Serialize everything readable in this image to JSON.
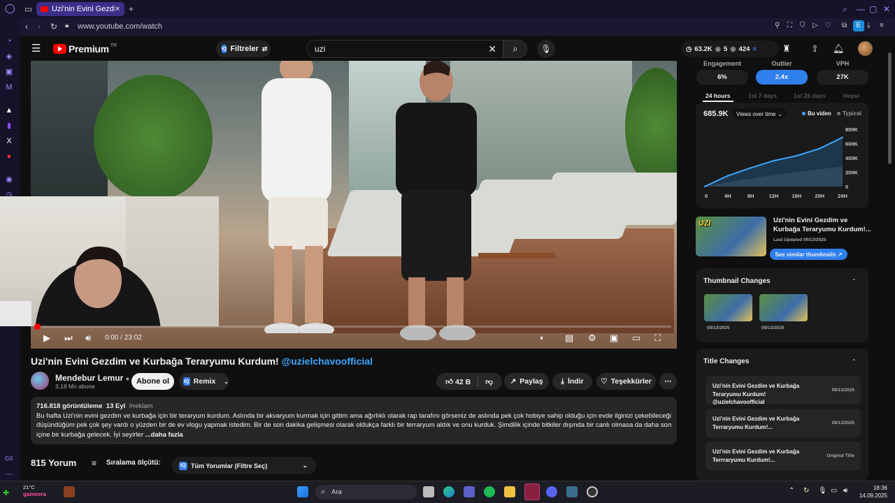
{
  "browser": {
    "tab_title": "Uzi'nin Evini Gezdim ve K",
    "url": "www.youtube.com/watch"
  },
  "header": {
    "logo": "Premium",
    "logo_region": "TR",
    "filter_label": "Filtreler",
    "search_value": "uzi",
    "stats": {
      "views": "63.2K",
      "count_a": "5",
      "count_b": "424"
    }
  },
  "video": {
    "time": "0:00 / 23:02",
    "title": "Uzi'nin Evini Gezdim ve Kurbağa Teraryumu Kurdum!",
    "title_tag": "@uzielchavoofficial",
    "progress": 0.002
  },
  "channel": {
    "name": "Mendebur Lemur",
    "subs": "3,18 Mn abone",
    "subscribe": "Abone ol",
    "remix": "Remix"
  },
  "actions": {
    "likes": "42 B",
    "share": "Paylaş",
    "download": "İndir",
    "thanks": "Teşekkürler"
  },
  "description": {
    "views": "716.818 görüntüleme",
    "date": "13 Eyl",
    "hashtag": "#reklam",
    "line1": "Bu hafta Uzi'nin evini gezdim ve kurbağa için bir teraryum kurdum.  Aslında bir akvaryum kurmak için gittim ama ağırlıklı olarak rap tarafını görseniz de aslında pek çok hobiye sahip olduğu için evde ilginizi çekebileceğini",
    "line2": "düşündüğüm pek çok şey vardı o yüzden bir de ev vlogu yapmak istedim. Bir de son dakika gelişmesi olarak oldukça farklı bir terraryum aldık ve onu kurduk. Şimdilik içinde bitkiler dışında bir canlı olmasa da daha sonra",
    "line3": "içine bir kurbağa gelecek. İyi seyirler",
    "more": "...daha fazla"
  },
  "comments": {
    "count": "815 Yorum",
    "sort_label": "Sıralama ölçütü:",
    "sort_value": "Tüm Yorumlar (Filtre Seç)"
  },
  "panel": {
    "metrics": [
      {
        "label": "Engagement",
        "value": "6%"
      },
      {
        "label": "Outlier",
        "value": "2.4x"
      },
      {
        "label": "VPH",
        "value": "27K"
      }
    ],
    "tabs": [
      "24 hours",
      "1st 7 days",
      "1st 28 days",
      "Hepsi"
    ],
    "views": "685.9K",
    "chart_mode": "Views over time",
    "legend_this": "Bu video",
    "legend_typical": "Typical",
    "thumb_title": "Uzi'nin Evini Gezdim ve Kurbağa Teraryumu Kurdum!...",
    "last_updated": "Last Updated 09/13/2025",
    "similar": "See similar thumbnails",
    "thumb_changes_title": "Thumbnail Changes",
    "thumb_dates": [
      "09/13/2025",
      "09/13/2025"
    ],
    "title_changes_title": "Title Changes",
    "title_changes": [
      {
        "text": "Uzi'nin Evini Gezdim ve Kurbağa Teraryumu Kurdum! @uzielchavoofficial",
        "date": "09/13/2025"
      },
      {
        "text": "Uzi'nin Evini Gezdim ve Kurbağa Terraryumu Kurdum!...",
        "date": "09/13/2025"
      },
      {
        "text": "Uzi'nin Evini Gezdim ve Kurbağa Terrraryumu Kurdum!...",
        "date": "Original Title"
      }
    ]
  },
  "chart_data": {
    "type": "area",
    "title": "",
    "x": [
      "0",
      "4H",
      "8H",
      "12H",
      "16H",
      "20H",
      "24H"
    ],
    "y_ticks": [
      "0",
      "200K",
      "400K",
      "600K",
      "800K"
    ],
    "ylim": [
      0,
      800000
    ],
    "series": [
      {
        "name": "Bu video",
        "values": [
          0,
          150000,
          260000,
          360000,
          430000,
          530000,
          686000
        ]
      },
      {
        "name": "Typical",
        "values": [
          0,
          60000,
          110000,
          160000,
          200000,
          240000,
          280000
        ]
      }
    ]
  },
  "taskbar": {
    "weather": "21°C",
    "search": "Ara",
    "time": "18:36",
    "date": "14.09.2025"
  }
}
